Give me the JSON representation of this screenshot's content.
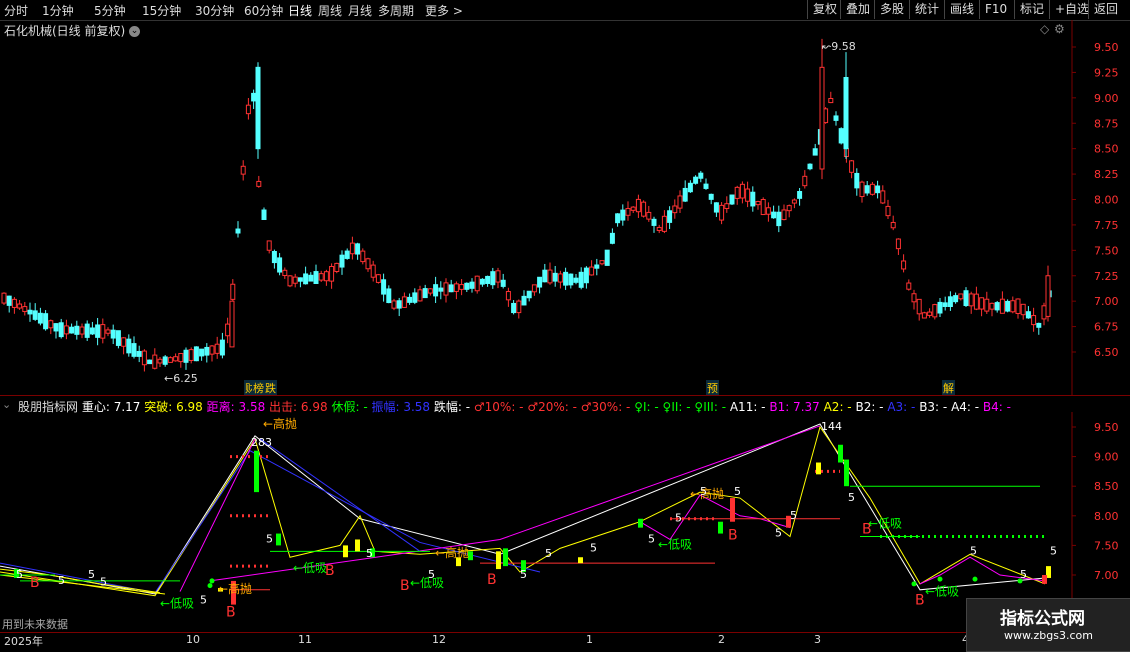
{
  "toolbar": {
    "left": [
      "分时",
      "1分钟",
      "5分钟",
      "15分钟",
      "30分钟",
      "60分钟",
      "日线",
      "周线",
      "月线",
      "多周期",
      "更多 >"
    ],
    "right": [
      "复权",
      "叠加",
      "多股",
      "统计",
      "画线",
      "F10",
      "标记",
      "+自选",
      "返回"
    ]
  },
  "main": {
    "title": "石化机械(日线 前复权)",
    "price_axis": [
      "9.50",
      "9.25",
      "9.00",
      "8.75",
      "8.50",
      "8.25",
      "8.00",
      "7.75",
      "7.50",
      "7.25",
      "7.00",
      "6.75",
      "6.50"
    ],
    "high_label": "9.58",
    "low_label": "6.25",
    "badges": [
      "财",
      "榜",
      "跌",
      "预",
      "解"
    ],
    "colors": {
      "up": "#ff3232",
      "down": "#54ffff",
      "bg": "#000000",
      "grid": "#7a0000"
    }
  },
  "indicator": {
    "name": "股朋指标网",
    "fields": [
      {
        "label": "重心: 7.17",
        "color": "#ffffff"
      },
      {
        "label": "突破: 6.98",
        "color": "#ffff00"
      },
      {
        "label": "距离: 3.58",
        "color": "#ff00ff"
      },
      {
        "label": "出击: 6.98",
        "color": "#ff3232"
      },
      {
        "label": "休假: -",
        "color": "#00ff00"
      },
      {
        "label": "振幅: 3.58",
        "color": "#3232ff"
      },
      {
        "label": "跌幅: -",
        "color": "#ffffff"
      },
      {
        "label": "♂10%: -",
        "color": "#ff3232"
      },
      {
        "label": "♂20%: -",
        "color": "#ff3232"
      },
      {
        "label": "♂30%: -",
        "color": "#ff3232"
      },
      {
        "label": "♀I: -",
        "color": "#00ff00"
      },
      {
        "label": "♀II: -",
        "color": "#00ff00"
      },
      {
        "label": "♀III: -",
        "color": "#00ff00"
      },
      {
        "label": "A11: -",
        "color": "#ffffff"
      },
      {
        "label": "B1: 7.37",
        "color": "#ff00ff"
      },
      {
        "label": "A2: -",
        "color": "#ffff00"
      },
      {
        "label": "B2: -",
        "color": "#ffffff"
      },
      {
        "label": "A3: -",
        "color": "#3232ff"
      },
      {
        "label": "B3: -",
        "color": "#ffffff"
      },
      {
        "label": "A4: -",
        "color": "#ffffff"
      },
      {
        "label": "B4: -",
        "color": "#ff00ff"
      }
    ],
    "axis": [
      "9.50",
      "9.00",
      "8.50",
      "8.00",
      "7.50",
      "7.00"
    ],
    "labels": {
      "high_sell": "←高抛",
      "low_buy": "←低吸",
      "buy": "B",
      "num_283": "283",
      "num_144": "144",
      "num_5": "5"
    }
  },
  "time_axis": [
    "2025年",
    "10",
    "11",
    "12",
    "1",
    "2",
    "3",
    "4"
  ],
  "footer": {
    "note": "用到未来数据"
  },
  "watermark": {
    "title": "指标公式网",
    "url": "www.zbgs3.com"
  }
}
